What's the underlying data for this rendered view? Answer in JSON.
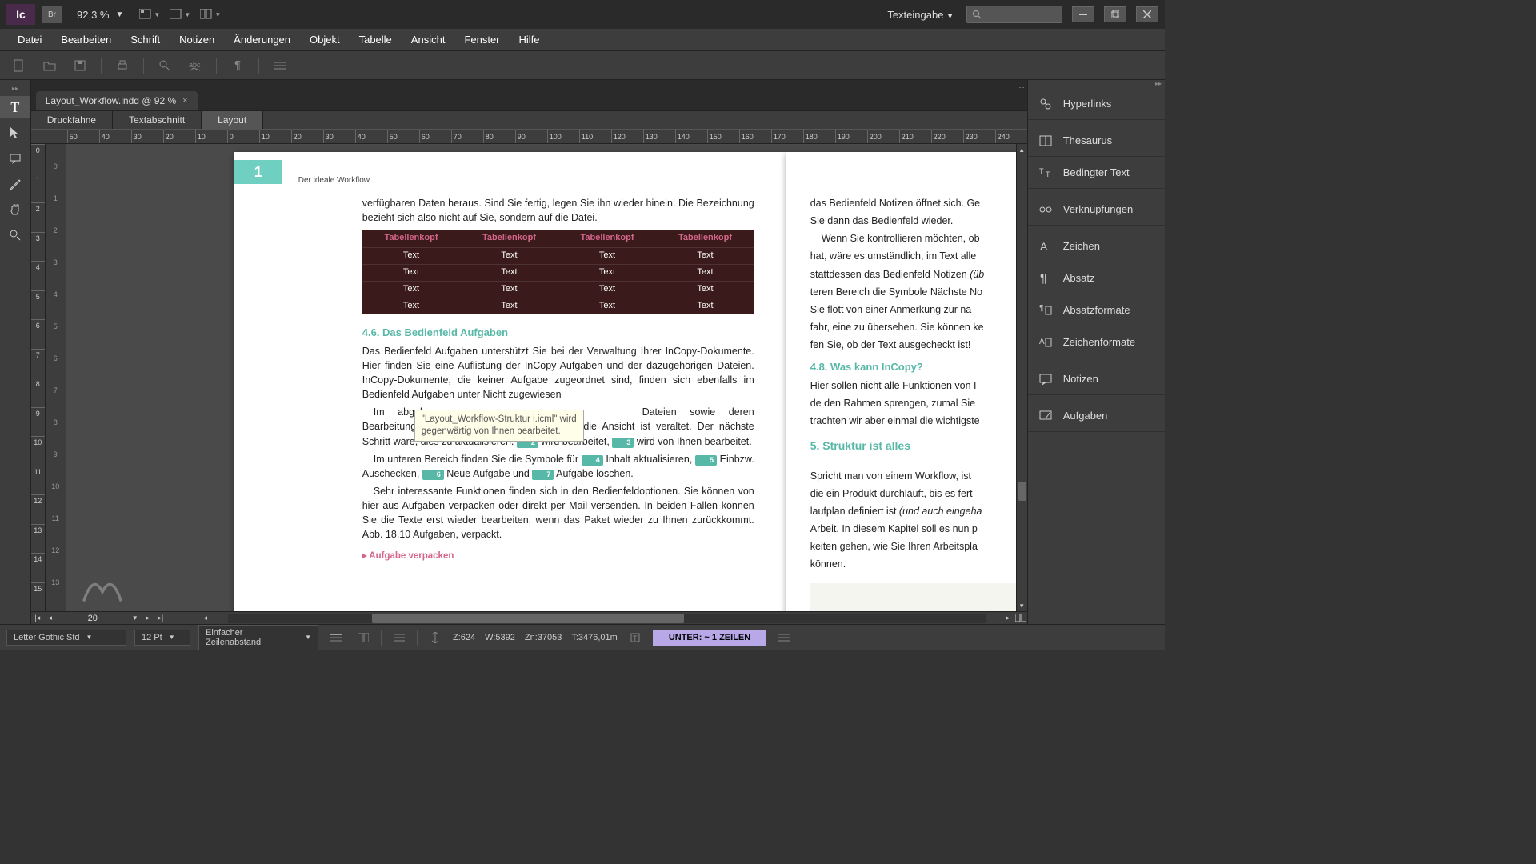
{
  "app": {
    "logo": "Ic",
    "br": "Br",
    "zoom": "92,3 %"
  },
  "window": {
    "mode": "Texteingabe"
  },
  "menu": {
    "items": [
      "Datei",
      "Bearbeiten",
      "Schrift",
      "Notizen",
      "Änderungen",
      "Objekt",
      "Tabelle",
      "Ansicht",
      "Fenster",
      "Hilfe"
    ]
  },
  "tab": {
    "title": "Layout_Workflow.indd @ 92 %"
  },
  "views": {
    "items": [
      "Druckfahne",
      "Textabschnitt",
      "Layout"
    ],
    "active": 2
  },
  "ruler_h": [
    "50",
    "40",
    "30",
    "20",
    "10",
    "0",
    "10",
    "20",
    "30",
    "40",
    "50",
    "60",
    "70",
    "80",
    "90",
    "100",
    "110",
    "120",
    "130",
    "140",
    "150",
    "160",
    "170",
    "180",
    "190",
    "200",
    "210",
    "220",
    "230",
    "240"
  ],
  "ruler_v": [
    "0",
    "1",
    "2",
    "3",
    "4",
    "5",
    "6",
    "7",
    "8",
    "9",
    "10",
    "11",
    "12",
    "13",
    "14",
    "15"
  ],
  "page_header": {
    "number": "1",
    "title": "Der ideale Workflow"
  },
  "content": {
    "para1": "verfügbaren Daten heraus. Sind Sie fertig, legen Sie ihn wieder hinein. Die Bezeichnung bezieht sich also nicht auf Sie, sondern auf die Datei.",
    "table": {
      "headers": [
        "Tabellenkopf",
        "Tabellenkopf",
        "Tabellenkopf",
        "Tabellenkopf"
      ],
      "cell": "Text",
      "rows": 4,
      "cols": 4
    },
    "h1": "4.6.  Das Bedienfeld Aufgaben",
    "para2": "Das Bedienfeld Aufgaben unterstützt Sie bei der Verwaltung Ihrer InCopy-Dokumente. Hier finden Sie eine Auflistung der InCopy-Aufgaben und der dazugehörigen Dateien. InCopy-Dokumente, die keiner Aufgabe zugeordnet sind, finden sich ebenfalls im Bedienfeld Aufgaben unter Nicht zugewiesen",
    "para3a": "Im abgeb",
    "para3b": "Dateien sowie deren Bearbeitungszustand.",
    "para3c": "ist verfügbar, aber die Ansicht ist veraltet. Der nächste Schritt wäre, dies zu aktualisieren.",
    "para3d": "wird bearbeitet,",
    "para3e": "wird von Ihnen bearbeitet.",
    "para4a": "Im unteren Bereich finden Sie die Symbole für",
    "para4b": "Inhalt aktualisieren,",
    "para4c": "Einbzw. Auschecken,",
    "para4d": "Neue Aufgabe und",
    "para4e": "Aufgabe löschen.",
    "para5": "Sehr interessante Funktionen finden sich in den Bedienfeldoptionen. Sie können von hier aus Aufgaben verpacken oder direkt per Mail versenden. In beiden Fällen können Sie die Texte erst wieder bearbeiten, wenn das Paket wieder zu Ihnen zurückkommt. Abb. 18.10 Aufgaben, verpackt.",
    "sub1": "Aufgabe verpacken",
    "chips": [
      "1",
      "2",
      "3",
      "4",
      "5",
      "6",
      "7"
    ]
  },
  "right_content": {
    "para1": "das Bedienfeld Notizen öffnet sich. Ge",
    "para1b": "Sie dann das Bedienfeld wieder.",
    "para2": "Wenn Sie kontrollieren möchten, ob",
    "para2b": "hat, wäre es umständlich, im Text alle",
    "para2c": "stattdessen das Bedienfeld Notizen",
    "para2d": "teren Bereich die Symbole Nächste No",
    "para2e": "Sie flott von einer Anmerkung zur nä",
    "para2f": "fahr, eine zu übersehen. Sie können ke",
    "para2g": "fen Sie, ob der Text ausgecheckt ist!",
    "h2": "4.8.  Was kann InCopy?",
    "para3": "Hier sollen nicht alle Funktionen von I",
    "para3b": "de den Rahmen sprengen, zumal Sie",
    "para3c": "trachten wir aber einmal die wichtigste",
    "h3": "5.  Struktur ist alles",
    "para4": "Spricht man von einem Workflow, ist",
    "para4b": "die ein Produkt durchläuft, bis es fert",
    "para4c": "laufplan definiert ist",
    "para4d": "Arbeit. In diesem Kapitel soll es nun p",
    "para4e": "keiten gehen, wie Sie Ihren Arbeitspla",
    "para4f": "können.",
    "ital1": "(üb",
    "ital2": "(und auch eingeha"
  },
  "tooltip": {
    "line1": "\"Layout_Workflow-Struktur i.icml\" wird",
    "line2": "gegenwärtig von Ihnen bearbeitet."
  },
  "right_panels": [
    "Hyperlinks",
    "Thesaurus",
    "Bedingter Text",
    "Verknüpfungen",
    "Zeichen",
    "Absatz",
    "Absatzformate",
    "Zeichenformate",
    "Notizen",
    "Aufgaben"
  ],
  "pagenav": {
    "page": "20"
  },
  "status": {
    "font": "Letter Gothic Std",
    "size": "12 Pt",
    "leading": "Einfacher Zeilenabstand",
    "z": "Z:624",
    "w": "W:5392",
    "zn": "Zn:37053",
    "t": "T:3476,01m",
    "fit": "UNTER:  ~ 1 ZEILEN"
  }
}
